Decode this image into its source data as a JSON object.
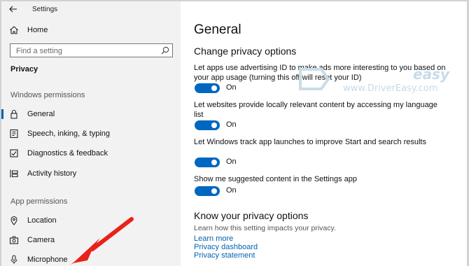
{
  "window": {
    "title": "Settings"
  },
  "sidebar": {
    "home_label": "Home",
    "search_placeholder": "Find a setting",
    "privacy_heading": "Privacy",
    "windows_permissions_label": "Windows permissions",
    "app_permissions_label": "App permissions",
    "items": [
      {
        "label": "General",
        "icon": "lock-icon",
        "selected": true
      },
      {
        "label": "Speech, inking, & typing",
        "icon": "speech-notebook-icon",
        "selected": false
      },
      {
        "label": "Diagnostics & feedback",
        "icon": "diagnostics-icon",
        "selected": false
      },
      {
        "label": "Activity history",
        "icon": "timeline-icon",
        "selected": false
      },
      {
        "label": "Location",
        "icon": "location-pin-icon",
        "selected": false
      },
      {
        "label": "Camera",
        "icon": "camera-icon",
        "selected": false
      },
      {
        "label": "Microphone",
        "icon": "microphone-icon",
        "selected": false
      }
    ]
  },
  "main": {
    "page_title": "General",
    "section_title": "Change privacy options",
    "options": [
      {
        "text": "Let apps use advertising ID to make ads more interesting to you based on your app usage (turning this off will reset your ID)",
        "state": "On"
      },
      {
        "text": "Let websites provide locally relevant content by accessing my language list",
        "state": "On"
      },
      {
        "text": "Let Windows track app launches to improve Start and search results",
        "state": "On"
      },
      {
        "text": "Show me suggested content in the Settings app",
        "state": "On"
      }
    ],
    "know_title": "Know your privacy options",
    "know_subtitle": "Learn how this setting impacts your privacy.",
    "links": [
      "Learn more",
      "Privacy dashboard",
      "Privacy statement"
    ]
  },
  "watermark": {
    "brand": "easy",
    "url": "www.DriverEasy.com"
  },
  "colors": {
    "accent": "#0067c0",
    "sidebar_bg": "#f2f2f2",
    "link": "#0063b1",
    "arrow": "#e8221a"
  }
}
